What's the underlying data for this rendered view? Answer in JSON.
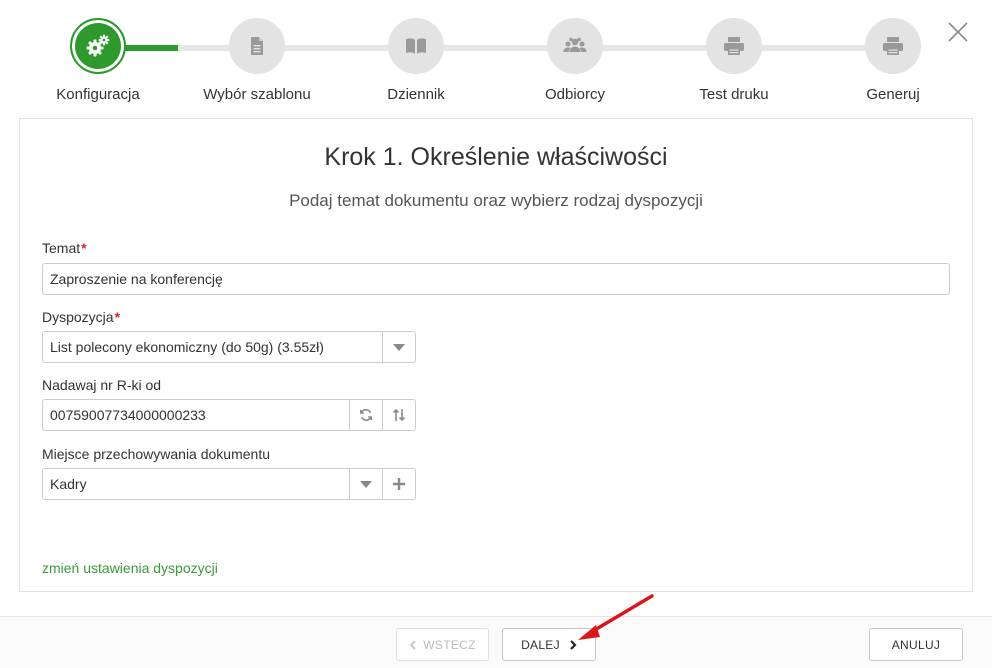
{
  "stepper": {
    "steps": [
      {
        "label": "Konfiguracja",
        "icon": "gears-icon"
      },
      {
        "label": "Wybór szablonu",
        "icon": "document-icon"
      },
      {
        "label": "Dziennik",
        "icon": "book-icon"
      },
      {
        "label": "Odbiorcy",
        "icon": "users-icon"
      },
      {
        "label": "Test druku",
        "icon": "printer-icon"
      },
      {
        "label": "Generuj",
        "icon": "printer-icon"
      }
    ],
    "active_step": 1
  },
  "main": {
    "title": "Krok 1. Określenie właściwości",
    "subtitle": "Podaj temat dokumentu oraz wybierz rodzaj dyspozycji"
  },
  "form": {
    "temat": {
      "label": "Temat",
      "value": "Zaproszenie na konferencję",
      "required_mark": "*"
    },
    "dyspozycja": {
      "label": "Dyspozycja",
      "value": "List polecony ekonomiczny (do 50g) (3.55zł)",
      "required_mark": "*"
    },
    "nr_rki": {
      "label": "Nadawaj nr R-ki od",
      "value": "00759007734000000233"
    },
    "miejsce": {
      "label": "Miejsce przechowywania dokumentu",
      "value": "Kadry"
    }
  },
  "links": {
    "change_settings": "zmień ustawienia dyspozycji"
  },
  "footer": {
    "back_label": "WSTECZ",
    "next_label": "DALEJ",
    "cancel_label": "ANULUJ"
  },
  "colors": {
    "accent": "#2e9a2e",
    "link": "#3a9a3a",
    "required": "#e02020",
    "annotation_arrow": "#d9161c"
  }
}
